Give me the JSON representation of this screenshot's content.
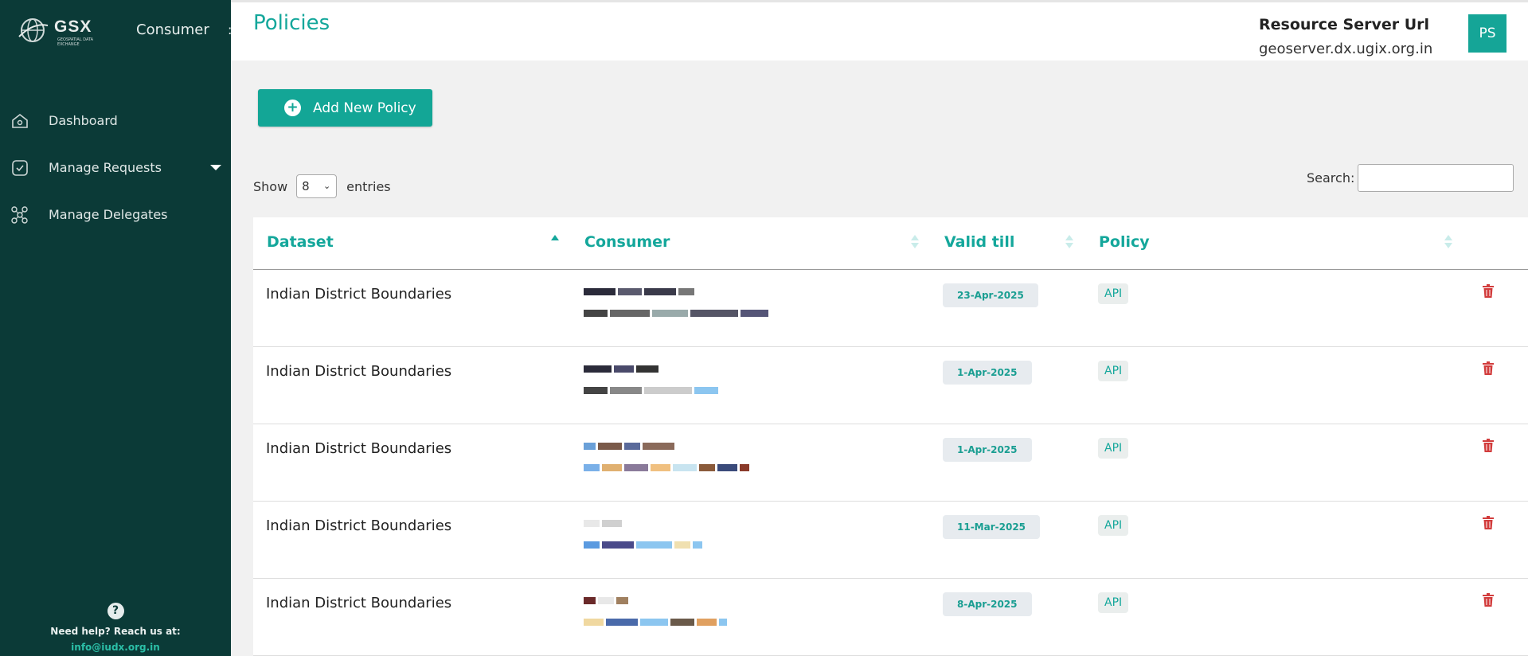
{
  "sidebar": {
    "brand": {
      "name": "GSX",
      "subtitle": "GEOSPATIAL DATA EXCHANGE"
    },
    "role": "Consumer",
    "items": [
      {
        "label": "Dashboard",
        "icon": "home-icon"
      },
      {
        "label": "Manage Requests",
        "icon": "check-square-icon"
      },
      {
        "label": "Manage Delegates",
        "icon": "network-icon"
      }
    ],
    "help": {
      "text": "Need help? Reach us at:",
      "email": "info@iudx.org.in"
    }
  },
  "header": {
    "title": "Policies",
    "resource_server_label": "Resource Server Url",
    "resource_server_url": "geoserver.dx.ugix.org.in",
    "avatar": "PS"
  },
  "main": {
    "add_button": "Add New Policy",
    "show_label": "Show",
    "show_value": "8",
    "entries_label": "entries",
    "search_label": "Search:",
    "search_value": ""
  },
  "table": {
    "columns": [
      "Dataset",
      "Consumer",
      "Valid till",
      "Policy"
    ],
    "rows": [
      {
        "dataset": "Indian District Boundaries",
        "valid_till": "23-Apr-2025",
        "policy": "API"
      },
      {
        "dataset": "Indian District Boundaries",
        "valid_till": "1-Apr-2025",
        "policy": "API"
      },
      {
        "dataset": "Indian District Boundaries",
        "valid_till": "1-Apr-2025",
        "policy": "API"
      },
      {
        "dataset": "Indian District Boundaries",
        "valid_till": "11-Mar-2025",
        "policy": "API"
      },
      {
        "dataset": "Indian District Boundaries",
        "valid_till": "8-Apr-2025",
        "policy": "API"
      }
    ]
  },
  "colors": {
    "sidebar_bg": "#0b3a37",
    "accent": "#14a79b",
    "delete": "#d23c3c"
  }
}
